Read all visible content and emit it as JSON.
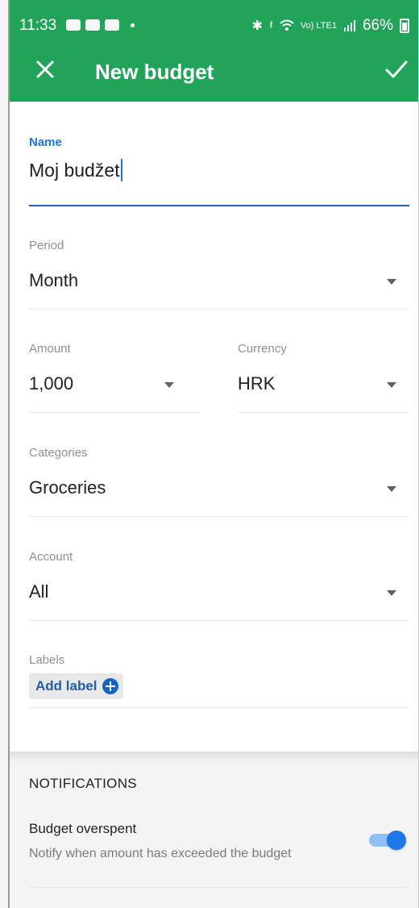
{
  "status_bar": {
    "time": "11:33",
    "bluetooth": "✱",
    "mute": "𝄽",
    "signal_text": "Vo) LTE1",
    "battery": "66%"
  },
  "toolbar": {
    "title": "New budget",
    "close_icon": "close-icon",
    "confirm_icon": "check-icon",
    "color": "#22a35a"
  },
  "form": {
    "name": {
      "label": "Name",
      "value": "Moj budžet"
    },
    "period": {
      "label": "Period",
      "value": "Month"
    },
    "amount": {
      "label": "Amount",
      "value": "1,000"
    },
    "currency": {
      "label": "Currency",
      "value": "HRK"
    },
    "categories": {
      "label": "Categories",
      "value": "Groceries"
    },
    "account": {
      "label": "Account",
      "value": "All"
    },
    "labels": {
      "label": "Labels",
      "add_label": "Add label"
    }
  },
  "notifications": {
    "title": "NOTIFICATIONS",
    "items": [
      {
        "name": "Budget overspent",
        "description": "Notify when amount has exceeded the budget",
        "enabled": true
      }
    ]
  }
}
